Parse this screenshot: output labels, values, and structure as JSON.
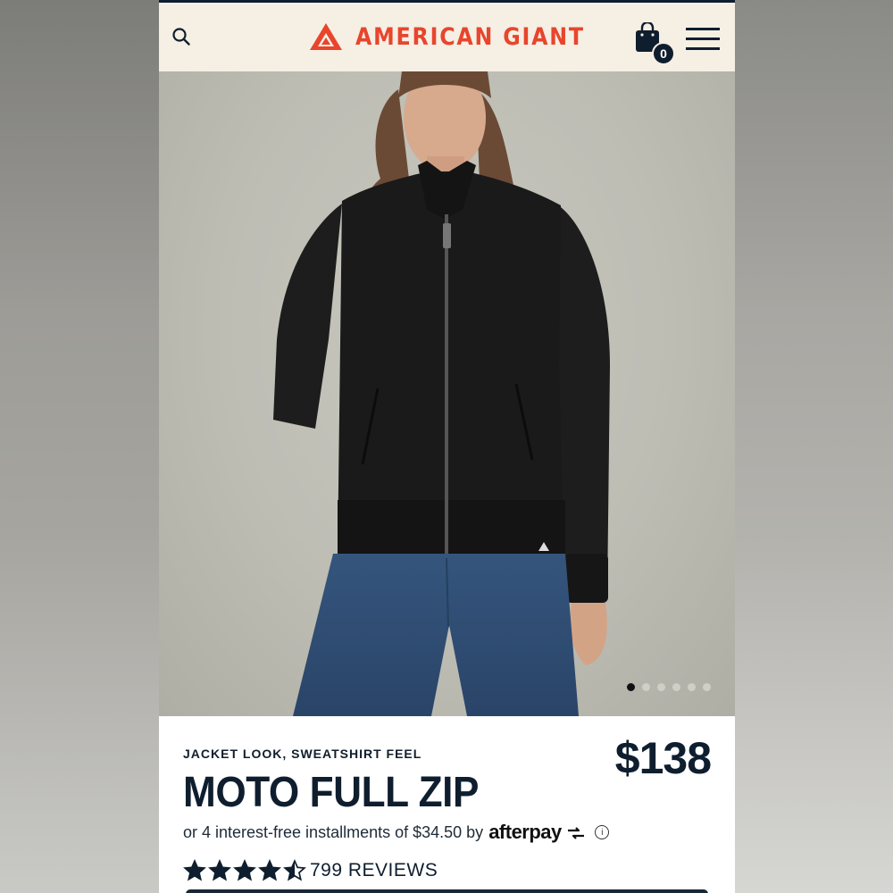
{
  "brand": {
    "name": "AMERICAN GIANT",
    "accent_color": "#e8452c",
    "ink_color": "#0f1e2e"
  },
  "header": {
    "search_icon": "search-icon",
    "cart": {
      "icon": "shopping-bag-icon",
      "count": "0"
    },
    "menu_icon": "hamburger-menu-icon"
  },
  "gallery": {
    "slide_count": 6,
    "active_index": 0
  },
  "product": {
    "eyebrow": "JACKET LOOK, SWEATSHIRT FEEL",
    "name": "MOTO FULL ZIP",
    "price": "$138",
    "installments_text": "or 4 interest-free installments of $34.50 by",
    "afterpay_label": "afterpay",
    "info_glyph": "i",
    "rating": 4.5,
    "rating_max": 5,
    "reviews_label": "799 REVIEWS"
  }
}
